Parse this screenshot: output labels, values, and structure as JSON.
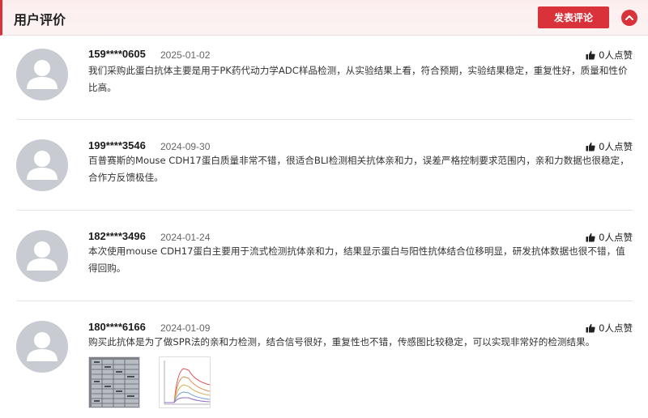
{
  "header": {
    "title": "用户评价",
    "post_button": "发表评论",
    "collapse_icon": "chevron-up-icon",
    "accent": "#d9323a"
  },
  "reviews": [
    {
      "user": "159****0605",
      "date": "2025-01-02",
      "likes": "0人点赞",
      "text": "我们采购此蛋白抗体主要是用于PK药代动力学ADC样品检测，从实验结果上看，符合预期，实验结果稳定，重复性好，质量和性价比高。"
    },
    {
      "user": "199****3546",
      "date": "2024-09-30",
      "likes": "0人点赞",
      "text": "百普赛斯的Mouse CDH17蛋白质量非常不错，很适合BLI检测相关抗体亲和力，误差严格控制要求范围内，亲和力数据也很稳定，合作方反馈极佳。"
    },
    {
      "user": "182****3496",
      "date": "2024-01-24",
      "likes": "0人点赞",
      "text": "本次使用mouse CDH17蛋白主要用于流式检测抗体亲和力，结果显示蛋白与阳性抗体结合位移明显，研发抗体数据也很不错，值得回购。"
    },
    {
      "user": "180****6166",
      "date": "2024-01-09",
      "likes": "0人点赞",
      "text": "购买此抗体是为了做SPR法的亲和力检测，结合信号很好，重复性也不错，传感图比较稳定，可以实现非常好的检测结果。"
    }
  ]
}
